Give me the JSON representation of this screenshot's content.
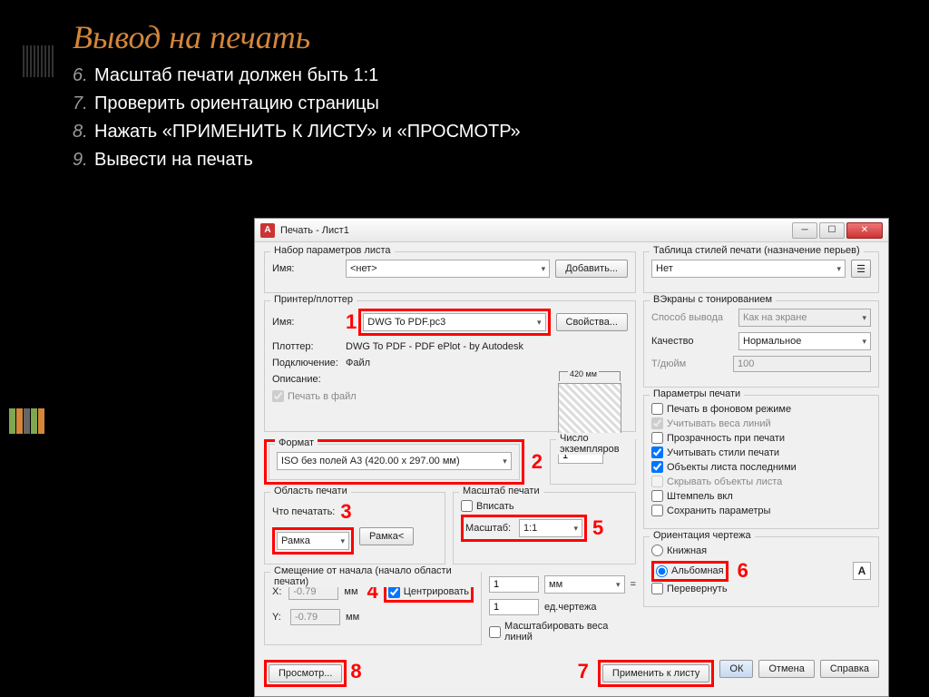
{
  "slide": {
    "title": "Вывод  на  печать",
    "items": [
      {
        "n": "6.",
        "t": "Масштаб печати должен быть 1:1"
      },
      {
        "n": "7.",
        "t": "Проверить ориентацию страницы"
      },
      {
        "n": "8.",
        "t": "Нажать «ПРИМЕНИТЬ К ЛИСТУ» и «ПРОСМОТР»"
      },
      {
        "n": "9.",
        "t": "Вывести на печать"
      }
    ]
  },
  "dialog": {
    "title": "Печать - Лист1",
    "paramset": {
      "title": "Набор параметров листа",
      "name_lbl": "Имя:",
      "name_val": "<нет>",
      "add_btn": "Добавить..."
    },
    "printer": {
      "title": "Принтер/плоттер",
      "name_lbl": "Имя:",
      "name_val": "DWG To PDF.pc3",
      "props_btn": "Свойства...",
      "plotter_lbl": "Плоттер:",
      "plotter_val": "DWG To PDF - PDF ePlot - by Autodesk",
      "conn_lbl": "Подключение:",
      "conn_val": "Файл",
      "desc_lbl": "Описание:",
      "tofile": "Печать в файл",
      "preview_dim": "420 мм"
    },
    "format": {
      "title": "Формат",
      "val": "ISO без полей A3 (420.00 x 297.00 мм)"
    },
    "copies": {
      "title": "Число экземпляров",
      "val": "1"
    },
    "area": {
      "title": "Область печати",
      "what_lbl": "Что печатать:",
      "val": "Рамка",
      "frame_btn": "Рамка<"
    },
    "scale": {
      "title": "Масштаб печати",
      "fit": "Вписать",
      "scale_lbl": "Масштаб:",
      "scale_val": "1:1",
      "unit1": "1",
      "unit1_u": "мм",
      "unit2": "1",
      "unit2_u": "ед.чертежа",
      "weights": "Масштабировать веса линий"
    },
    "offset": {
      "title": "Смещение от начала (начало области печати)",
      "x_lbl": "X:",
      "x_val": "-0.79",
      "x_u": "мм",
      "y_lbl": "Y:",
      "y_val": "-0.79",
      "y_u": "мм",
      "center": "Центрировать"
    },
    "styles": {
      "title": "Таблица стилей печати (назначение перьев)",
      "val": "Нет"
    },
    "vport": {
      "title": "ВЭкраны с тонированием",
      "method_lbl": "Способ вывода",
      "method_val": "Как на экране",
      "quality_lbl": "Качество",
      "quality_val": "Нормальное",
      "dpi_lbl": "Т/дюйм",
      "dpi_val": "100"
    },
    "opts": {
      "title": "Параметры печати",
      "o1": "Печать в фоновом режиме",
      "o2": "Учитывать веса линий",
      "o3": "Прозрачность при печати",
      "o4": "Учитывать стили печати",
      "o5": "Объекты листа последними",
      "o6": "Скрывать объекты листа",
      "o7": "Штемпель вкл",
      "o8": "Сохранить параметры"
    },
    "orient": {
      "title": "Ориентация чертежа",
      "portrait": "Книжная",
      "landscape": "Альбомная",
      "flip": "Перевернуть"
    },
    "btns": {
      "preview": "Просмотр...",
      "apply": "Применить к листу",
      "ok": "ОК",
      "cancel": "Отмена",
      "help": "Справка"
    },
    "nums": {
      "n1": "1",
      "n2": "2",
      "n3": "3",
      "n4": "4",
      "n5": "5",
      "n6": "6",
      "n7": "7",
      "n8": "8"
    }
  }
}
